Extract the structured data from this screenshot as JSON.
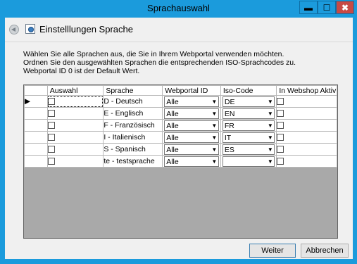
{
  "window": {
    "title": "Sprachauswahl",
    "controls": {
      "minimize": "▬",
      "maximize": "☐",
      "close": "✖"
    }
  },
  "header": {
    "title": "Einstelllungen Sprache"
  },
  "description": [
    "Wählen Sie alle Sprachen aus, die Sie in Ihrem Webportal verwenden möchten.",
    "Ordnen Sie den ausgewählten Sprachen die entsprechenden ISO-Sprachcodes zu.",
    "Webportal ID 0 ist der Default Wert."
  ],
  "grid": {
    "columns": [
      "Auswahl",
      "Sprache",
      "Webportal ID",
      "Iso-Code",
      "In Webshop Aktiv"
    ],
    "current_row_indicator": "▶",
    "rows": [
      {
        "auswahl": false,
        "sprache": "D - Deutsch",
        "webportal": "Alle",
        "iso": "DE",
        "aktiv": false
      },
      {
        "auswahl": false,
        "sprache": "E - Englisch",
        "webportal": "Alle",
        "iso": "EN",
        "aktiv": false
      },
      {
        "auswahl": false,
        "sprache": "F - Französisch",
        "webportal": "Alle",
        "iso": "FR",
        "aktiv": false
      },
      {
        "auswahl": false,
        "sprache": "I - Italienisch",
        "webportal": "Alle",
        "iso": "IT",
        "aktiv": false
      },
      {
        "auswahl": false,
        "sprache": "S - Spanisch",
        "webportal": "Alle",
        "iso": "ES",
        "aktiv": false
      },
      {
        "auswahl": false,
        "sprache": "te - testsprache",
        "webportal": "Alle",
        "iso": "",
        "aktiv": false
      }
    ]
  },
  "buttons": {
    "next": "Weiter",
    "cancel": "Abbrechen"
  },
  "colors": {
    "titlebar": "#1b9bdc",
    "close": "#c74a45",
    "grid_empty": "#a9a9a9"
  }
}
